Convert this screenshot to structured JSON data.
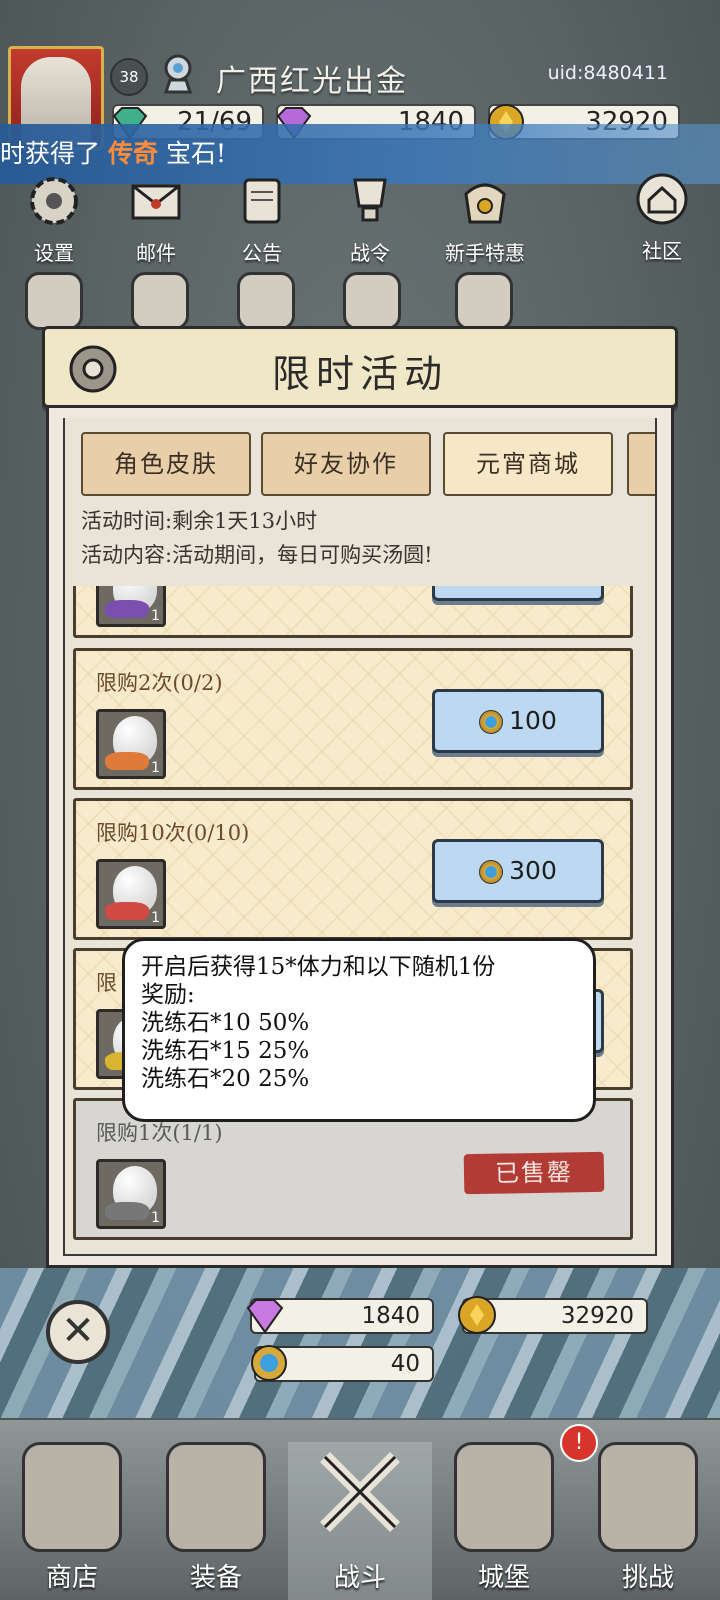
{
  "player": {
    "level": "38",
    "name": "广西红光出金",
    "uid": "uid:8480411"
  },
  "resources_top": {
    "stamina": "21/69",
    "purple_gem": "1840",
    "gold": "32920"
  },
  "banner": {
    "prefix": "时获得了",
    "highlight": "传奇",
    "suffix": "宝石!"
  },
  "menu_row1": [
    {
      "label": "设置",
      "icon": "gear-icon"
    },
    {
      "label": "邮件",
      "icon": "mail-icon"
    },
    {
      "label": "公告",
      "icon": "scroll-icon"
    },
    {
      "label": "战令",
      "icon": "trophy-icon"
    },
    {
      "label": "新手特惠",
      "icon": "bag-icon"
    },
    {
      "label": "社区",
      "icon": "home-icon"
    }
  ],
  "popup": {
    "title": "限时活动",
    "tabs": [
      "角色皮肤",
      "好友协作",
      "元宵商城",
      ""
    ],
    "active_tab": "元宵商城",
    "time_text": "活动时间:剩余1天13小时",
    "content_text": "活动内容:活动期间，每日可购买汤圆!",
    "items": [
      {
        "label": "",
        "price": "",
        "count": "1",
        "color": "#7b4fb0"
      },
      {
        "label": "限购2次(0/2)",
        "price": "100",
        "count": "1",
        "color": "#e07a3a"
      },
      {
        "label": "限购10次(0/10)",
        "price": "300",
        "count": "1",
        "color": "#d24a44"
      },
      {
        "label": "限",
        "price": "",
        "count": "1",
        "color": "#d8b432"
      },
      {
        "label": "限购1次(1/1)",
        "status": "已售罄",
        "count": "1",
        "color": "#777777"
      }
    ]
  },
  "tooltip": {
    "line1": "开启后获得15*体力和以下随机1份",
    "line2": "奖励:",
    "line3": "洗练石*10  50%",
    "line4": "洗练石*15  25%",
    "line5": "洗练石*20  25%"
  },
  "wallet": {
    "purple_gem": "1840",
    "gold": "32920",
    "coin": "40"
  },
  "nav": [
    {
      "label": "商店",
      "icon": "shop-icon"
    },
    {
      "label": "装备",
      "icon": "backpack-icon"
    },
    {
      "label": "战斗",
      "icon": "crossed-swords-icon"
    },
    {
      "label": "城堡",
      "icon": "castle-icon"
    },
    {
      "label": "挑战",
      "icon": "shield-icon"
    }
  ],
  "nav_badge": "!",
  "colors": {
    "banner_highlight": "#ff8c3a",
    "buy_button": "#bcd9f1",
    "sold_out": "#b23b35"
  }
}
